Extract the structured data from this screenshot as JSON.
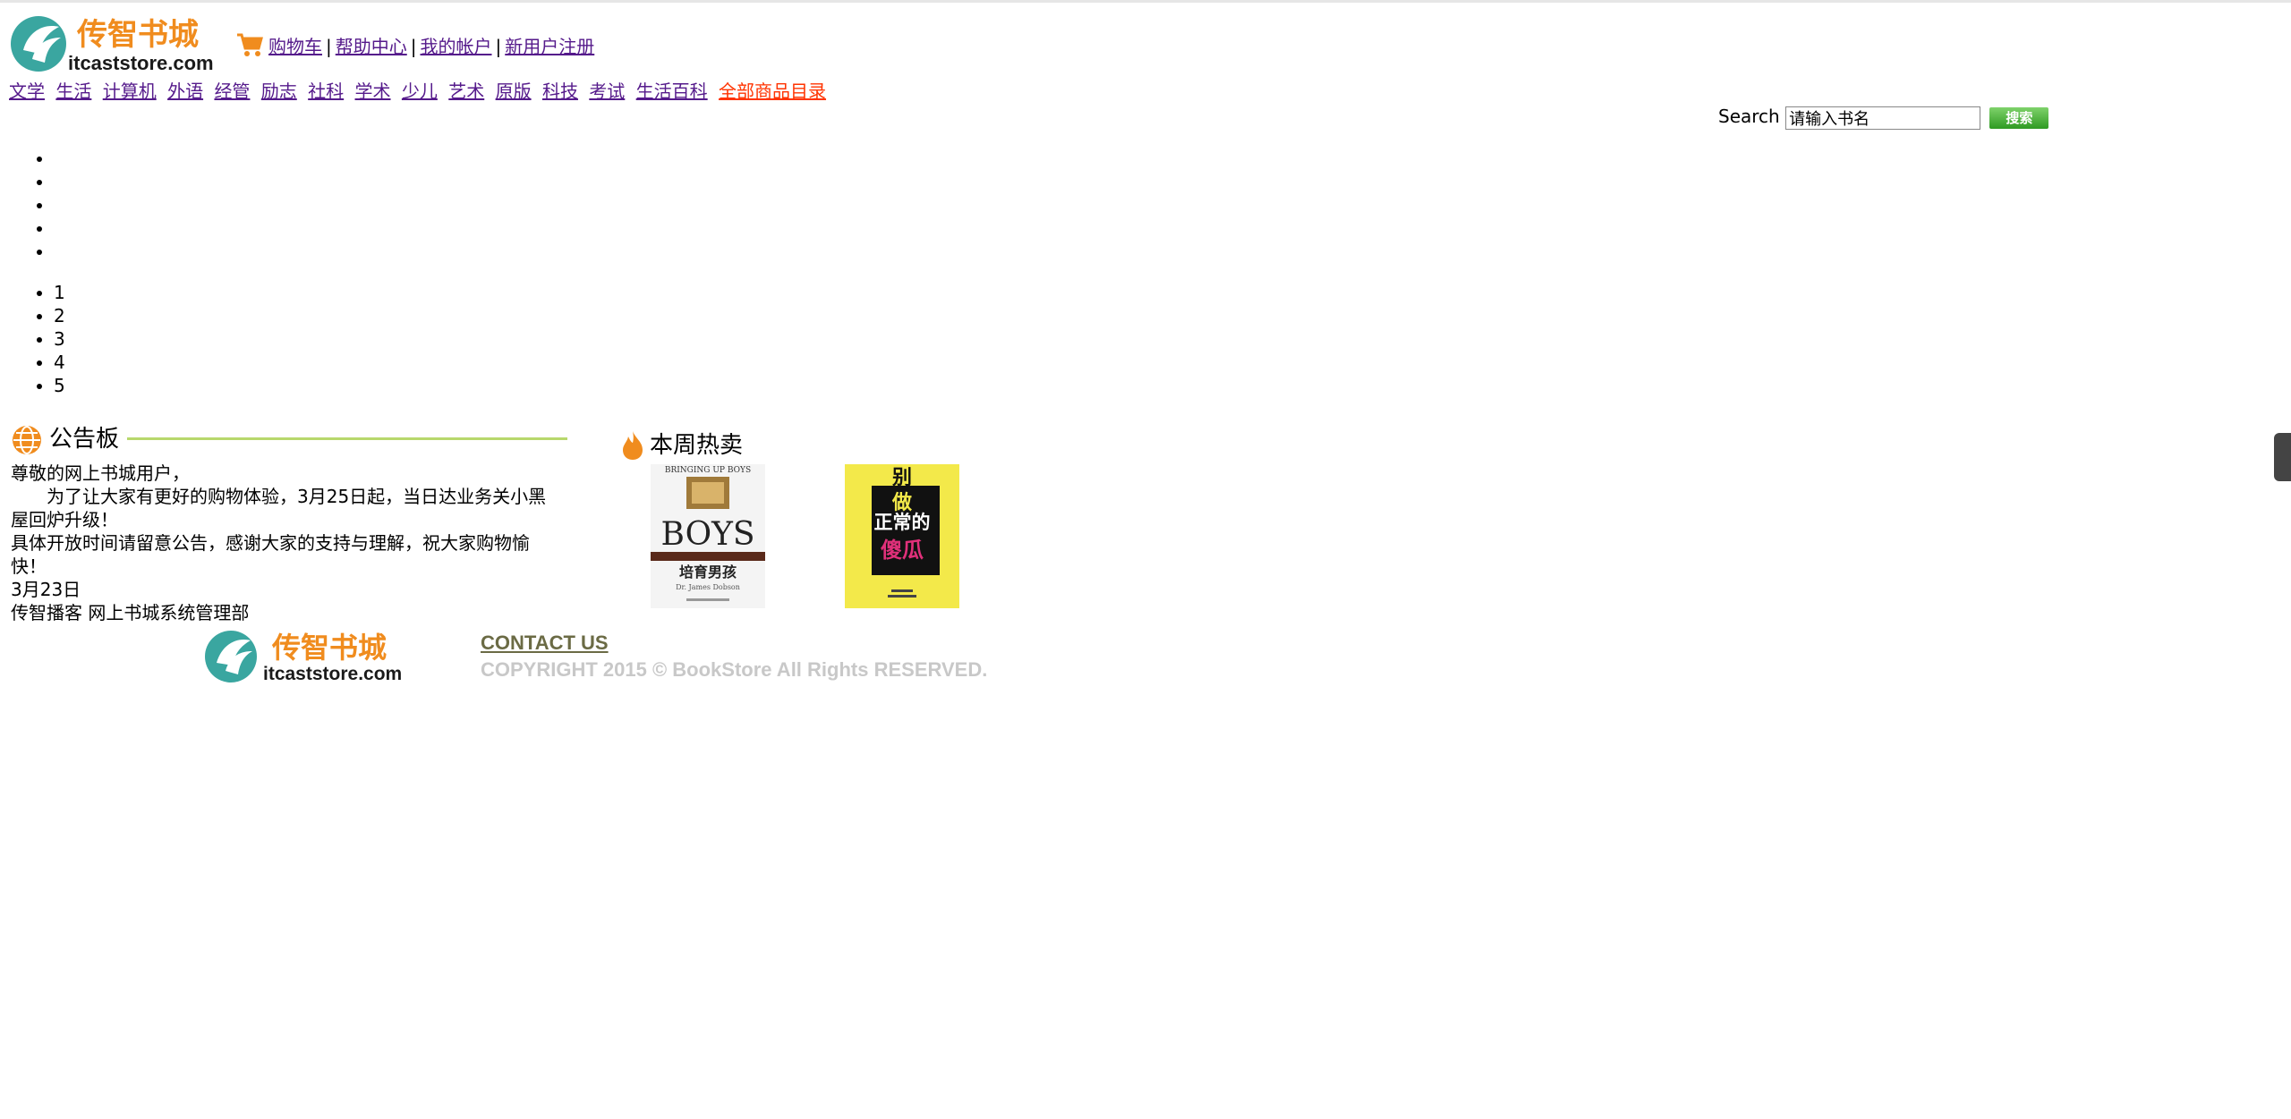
{
  "header": {
    "logo_cn": "传智书城",
    "logo_en": "itcaststore.com",
    "links": [
      "购物车",
      "帮助中心",
      "我的帐户",
      "新用户注册"
    ],
    "separator": "|"
  },
  "categories": [
    "文学",
    "生活",
    "计算机",
    "外语",
    "经管",
    "励志",
    "社科",
    "学术",
    "少儿",
    "艺术",
    "原版",
    "科技",
    "考试",
    "生活百科"
  ],
  "all_categories": "全部商品目录",
  "search": {
    "label": "Search",
    "value": "请输入书名",
    "button": "搜索"
  },
  "slide_indicators": [
    "",
    "",
    "",
    "",
    ""
  ],
  "slide_numbers": [
    "1",
    "2",
    "3",
    "4",
    "5"
  ],
  "bulletin": {
    "title": "公告板",
    "lines": [
      "尊敬的网上书城用户，",
      "为了让大家有更好的购物体验，3月25日起，当日达业务关小黑屋回炉升级！",
      "具体开放时间请留意公告，感谢大家的支持与理解，祝大家购物愉快！",
      "3月23日",
      "传智播客 网上书城系统管理部"
    ]
  },
  "hot": {
    "title": "本周热卖",
    "books": [
      {
        "top": "BRINGING UP BOYS",
        "big": "BOYS",
        "cn": "培育男孩",
        "author": "Dr. James Dobson"
      },
      {
        "line1": "别",
        "line2": "做",
        "line3": "正常的",
        "line4": "傻瓜"
      }
    ]
  },
  "footer": {
    "logo_cn": "传智书城",
    "logo_en": "itcaststore.com",
    "contact": "CONTACT US",
    "copyright": "COPYRIGHT 2015 © BookStore All Rights RESERVED."
  },
  "colors": {
    "link": "#551a8b",
    "all_categories": "#ff3300",
    "logo_orange": "#f08c1e",
    "logo_teal": "#3aa6a0",
    "bulletin_line": "#b8d86c",
    "search_button": "#3aa82c"
  }
}
